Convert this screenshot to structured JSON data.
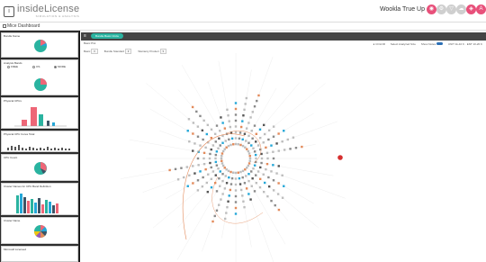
{
  "topbar": {
    "logo_mark": "i",
    "logo_name": "insideLicense",
    "logo_tagline": "Simulation & Analysis",
    "page_title": "Wookla True Up",
    "actions": [
      {
        "icon": "globe-icon",
        "glyph": "◉",
        "color": "#e8507a"
      },
      {
        "icon": "settings-icon",
        "glyph": "⚙",
        "color": "#cfcfcf"
      },
      {
        "icon": "filter-icon",
        "glyph": "▽",
        "color": "#cfcfcf"
      },
      {
        "icon": "cloud-icon",
        "glyph": "☁",
        "color": "#cfcfcf"
      },
      {
        "icon": "share-icon",
        "glyph": "◈",
        "color": "#e8507a"
      },
      {
        "icon": "user-icon",
        "glyph": "A",
        "color": "#e8507a"
      }
    ]
  },
  "breadcrumb": {
    "label": "Mice Dashboard"
  },
  "sidebar": {
    "cards": [
      {
        "title": "Bundle Name"
      },
      {
        "title": "Analysis Bands",
        "radios": [
          "FREE",
          "OS",
          "MORE"
        ]
      },
      {
        "title": "Physical CPUs"
      },
      {
        "title": "Physical CPU Cores Total"
      },
      {
        "title": "CPU Count"
      },
      {
        "title": "Cluster Names for CPU Band Definition"
      },
      {
        "title": "Cluster Name"
      },
      {
        "title": "Microsoft Licensed"
      }
    ]
  },
  "main": {
    "tab_label": "Bundle Basic Circle",
    "mode_label": "Basic Plot",
    "controls": {
      "a": "COLOR",
      "b": "Select Analyzed Size",
      "c": "Show Notes",
      "range": "UNIT 1k-10 K · ENT 10-20 K"
    },
    "filters": [
      "Basic",
      "Bundle Standard",
      "Warranty Product"
    ],
    "kpis": [
      {
        "value": "17",
        "label": "Clusters",
        "color": "#2ab3a0"
      },
      {
        "value": "207",
        "label": "Load Grp",
        "color": "#ee6677"
      },
      {
        "value": "31",
        "label": "Units to Update",
        "color": "#23a7d8"
      },
      {
        "value": "249",
        "label": "Independent Units",
        "color": "#3d5466"
      }
    ]
  },
  "colors": {
    "teal": "#2ab3a0",
    "pink": "#ee6677",
    "blue": "#23a7d8",
    "slate": "#3d5466",
    "orange": "#e38a5a",
    "red": "#d62f2f"
  }
}
